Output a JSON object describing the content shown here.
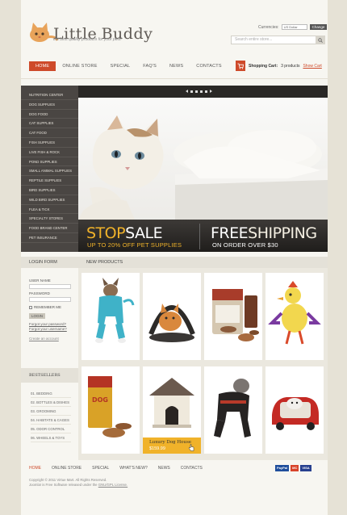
{
  "header": {
    "title_part1": "Little",
    "title_part2": "Buddy",
    "tagline": "the best quality products for your pets!",
    "currencies_label": "Currencies:",
    "currency_selected": "US Dollar",
    "change_label": "Change",
    "search_placeholder": "Search entire store..."
  },
  "nav": {
    "items": [
      "HOME",
      "ONLINE STORE",
      "SPECIAL",
      "FAQ'S",
      "NEWS",
      "CONTACTS"
    ]
  },
  "cart": {
    "label": "Shopping Cart:",
    "count": "3 products",
    "show": "Show Cart"
  },
  "sidebar": {
    "categories": [
      "NUTRITION CENTER",
      "DOG SUPPLIES",
      "DOG FOOD",
      "CAT SUPPLIES",
      "CAT FOOD",
      "FISH SUPPLIES",
      "LIVE FISH & ROCK",
      "POND SUPPLIES",
      "SMALL ANIMAL SUPPLIES",
      "REPTILE SUPPLIES",
      "BIRD SUPPLIES",
      "WILD BIRD SUPPLIES",
      "FLEA & TICK",
      "SPECIALTY STORES",
      "FOOD BRAND CENTER",
      "PET INSURANCE"
    ]
  },
  "banner": {
    "promo1_a": "STOP",
    "promo1_b": "SALE",
    "promo1_sub": "UP TO 20% OFF PET SUPPLIES",
    "promo2_a": "FREE",
    "promo2_b": "SHIPPING",
    "promo2_sub": "ON ORDER OVER $30"
  },
  "login": {
    "heading": "LOGIN FORM",
    "user_label": "USER NAME",
    "pass_label": "PASSWORD",
    "remember": "REMEMBER ME",
    "button": "LOGIN",
    "forgot_pass": "Forgot your password?",
    "forgot_user": "Forgot your username?",
    "create": "Create an account"
  },
  "bestsellers": {
    "heading": "BESTSELLERS",
    "items": [
      "01. BEDDING",
      "02. BOTTLES & DISHES",
      "03. GROOMING",
      "04. HABITATS & CAGES",
      "05. ODOR CONTROL",
      "06. WHEELS & TOYS"
    ]
  },
  "products": {
    "heading": "NEW PRODUCTS",
    "highlight_name": "Luxury Dog House",
    "highlight_price": "$159.99"
  },
  "footer": {
    "nav": [
      "HOME",
      "ONLINE STORE",
      "SPECIAL",
      "WHAT'S NEW?",
      "NEWS",
      "CONTACTS"
    ],
    "copyright": "Copyright © 2011 Virtue Mart. All Rights Reserved.",
    "license_pre": "Joomla! is Free Software released under the",
    "license_link": "GNU/GPL License.",
    "cards": [
      "PayPal",
      "MC",
      "VISA"
    ]
  },
  "colors": {
    "accent": "#ce4a2a",
    "sidebar": "#4a4643",
    "yellow": "#f0b22a"
  }
}
